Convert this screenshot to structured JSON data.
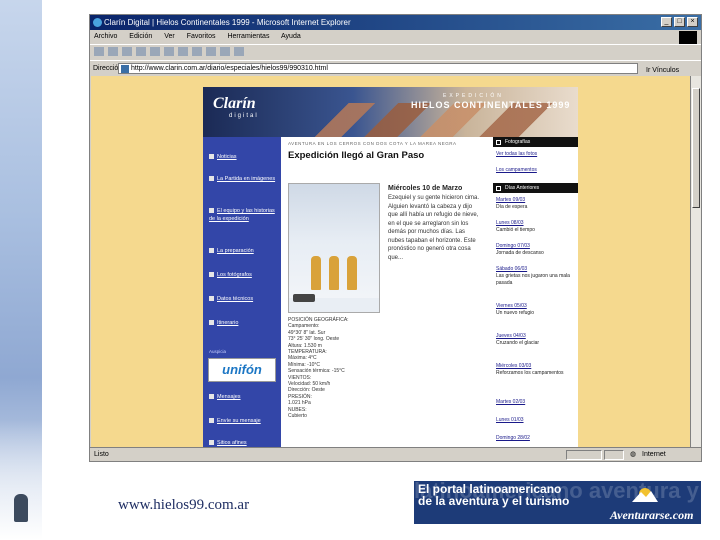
{
  "window": {
    "title": "Clarín Digital | Hielos Continentales 1999 - Microsoft Internet Explorer",
    "controls": [
      "_",
      "□",
      "×"
    ]
  },
  "menu": [
    "Archivo",
    "Edición",
    "Ver",
    "Favoritos",
    "Herramientas",
    "Ayuda"
  ],
  "address": {
    "label": "Dirección",
    "url": "http://www.clarin.com.ar/diario/especiales/hielos99/990310.html",
    "go_label": "Ir",
    "links_label": "Vínculos"
  },
  "site": {
    "logo": "Clarín",
    "logo_sub": "digital",
    "header_kicker": "EXPEDICIÓN",
    "header_title": "HIELOS CONTINENTALES 1999",
    "nav": [
      "Noticias",
      "La Partida en imágenes",
      "El equipo y las historias de la expedición",
      "La preparación",
      "Los fotógrafos",
      "Datos técnicos",
      "Itinerario",
      "Mensajes",
      "Envíe su mensaje",
      "Sitios afines"
    ],
    "sponsor_label": "Auspicia",
    "sponsor": "unifón",
    "strip_label": "AVENTURA EN LOS CERROS CON DOS COTA Y LA MAREA NEGRA",
    "headline": "Expedición llegó al Gran Paso",
    "article_date": "Miércoles 10 de Marzo",
    "article_text": "Ezequiel y su gente hicieron cima. Alguien levantó la cabeza y dijo que allí había un refugio de nieve, en el que se arreglaron sin los demás por muchos días. Las nubes tapaban el horizonte. Este pronóstico no generó otra cosa que...",
    "facts": [
      "POSICIÓN GEOGRÁFICA:",
      "Campamento:",
      "49°30' 8\" lat. Sur",
      "73° 25' 30\" long. Oeste",
      "Altura: 1.530 m",
      "TEMPERATURA:",
      "Máxima: 4°C",
      "Mínima: -10°C",
      "Sensación térmica: -15°C",
      "VIENTOS:",
      "Velocidad: 50 km/h",
      "Dirección: Oeste",
      "PRESIÓN:",
      "1.021 hPa",
      "NUBES:",
      "Cubierto"
    ],
    "right_col": {
      "section1": "Fotografías",
      "section1_links": [
        "Ver todas las fotos",
        "Los campamentos"
      ],
      "section2": "Días Anteriores",
      "entries": [
        {
          "date": "Martes 09/03",
          "text": "Día de espera"
        },
        {
          "date": "Lunes 08/03",
          "text": "Cambió el tiempo"
        },
        {
          "date": "Domingo 07/03",
          "text": "Jornada de descanso"
        },
        {
          "date": "Sábado 06/03",
          "text": "Las grietas nos jugaron una mala pasada"
        },
        {
          "date": "Viernes 05/03",
          "text": "Un nuevo refugio"
        },
        {
          "date": "Jueves 04/03",
          "text": "Cruzando el glaciar"
        },
        {
          "date": "Miércoles 03/03",
          "text": "Reforzamos los campamentos"
        },
        {
          "date": "Martes 02/03",
          "text": ""
        },
        {
          "date": "Lunes 01/03",
          "text": ""
        },
        {
          "date": "Domingo 28/02",
          "text": ""
        }
      ]
    }
  },
  "status": {
    "text": "Listo",
    "zone": "Internet"
  },
  "footer": {
    "url": "www.hielos99.com.ar",
    "banner_line1": "El portal latinoamericano",
    "banner_line2": "de la aventura y el turismo",
    "banner_ghost": "latinoamericano aventura y el turismo",
    "banner_logo": "Aventurarse.com"
  },
  "colors": {
    "page_bg": "#f5d98e",
    "nav_bg": "#3346a8",
    "titlebar": "#0a246a",
    "banner_bg": "#1d3b78"
  }
}
